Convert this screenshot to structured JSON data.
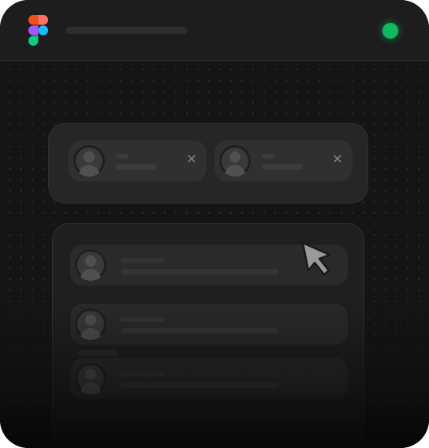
{
  "window": {
    "app_icon": "figma-logo-icon",
    "title": "",
    "status_dot_color": "#11b85f"
  },
  "selected_users": [
    {
      "name": "",
      "detail": "",
      "remove_icon": "close-icon",
      "remove_label": "✕"
    },
    {
      "name": "",
      "detail": "",
      "remove_icon": "close-icon",
      "remove_label": "✕"
    }
  ],
  "user_list": [
    {
      "name": "",
      "detail": ""
    },
    {
      "name": "",
      "detail": ""
    },
    {
      "name": "",
      "detail": ""
    }
  ],
  "cursor": {
    "icon": "pointer-cursor-icon"
  },
  "colors": {
    "window_bg": "#161616",
    "panel_bg": "#262626",
    "chip_bg": "#303030",
    "accent_green": "#11b85f"
  }
}
